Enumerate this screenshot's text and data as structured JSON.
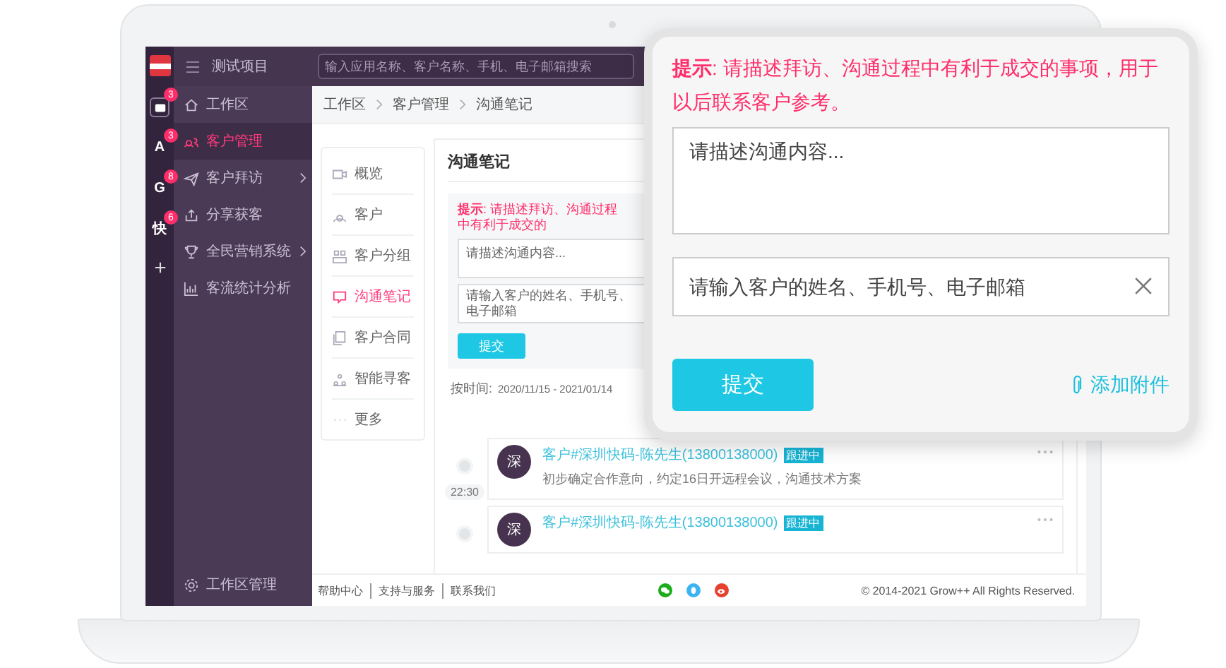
{
  "app": {
    "project": "测试项目",
    "search": {
      "placeholder": "输入应用名称、客户名称、手机、电子邮箱搜索"
    }
  },
  "rail": {
    "items": [
      {
        "badge": "3",
        "selected": true
      },
      {
        "label": "A",
        "badge": "3",
        "selected": false
      },
      {
        "label": "G",
        "badge": "8",
        "selected": false
      },
      {
        "label": "快",
        "badge": "6",
        "selected": false
      }
    ]
  },
  "sidebar": {
    "items": [
      {
        "label": "工作区",
        "selected": false,
        "has_submenu": false
      },
      {
        "label": "客户管理",
        "selected": true,
        "has_submenu": false
      },
      {
        "label": "客户拜访",
        "selected": false,
        "has_submenu": true
      },
      {
        "label": "分享获客",
        "selected": false,
        "has_submenu": false
      },
      {
        "label": "全民营销系统",
        "selected": false,
        "has_submenu": true
      },
      {
        "label": "客流统计分析",
        "selected": false,
        "has_submenu": false
      }
    ],
    "footer_item": "工作区管理"
  },
  "breadcrumb": [
    "工作区",
    "客户管理",
    "沟通笔记"
  ],
  "submenu": {
    "items": [
      {
        "label": "概览",
        "selected": false
      },
      {
        "label": "客户",
        "selected": false
      },
      {
        "label": "客户分组",
        "selected": false
      },
      {
        "label": "沟通笔记",
        "selected": true
      },
      {
        "label": "客户合同",
        "selected": false
      },
      {
        "label": "智能寻客",
        "selected": false
      },
      {
        "label": "更多",
        "selected": false
      }
    ]
  },
  "notes": {
    "title": "沟通笔记",
    "hint": "**提示**: 请描述拜访、沟通过程中有利于成交的",
    "content": {
      "placeholder": "请描述沟通内容..."
    },
    "customer": {
      "placeholder": "请输入客户的姓名、手机号、电子邮箱"
    },
    "submit": "提交",
    "filter": {
      "label": "按时间:",
      "range": "2020/11/15 - 2021/01/14"
    },
    "feed": [
      {
        "avatar": "深",
        "title": "客户#深圳快码-陈先生(13800138000)",
        "status": "跟进中",
        "text": "初步确定合作意向，约定16日开远程会议，沟通技术方案",
        "time": "22:30"
      },
      {
        "avatar": "深",
        "title": "客户#深圳快码-陈先生(13800138000)",
        "status": "跟进中"
      }
    ]
  },
  "footer": {
    "links": [
      "帮助中心",
      "支持与服务",
      "联系我们"
    ],
    "copyright": "© 2014-2021 Grow++ All Rights Reserved."
  },
  "popup": {
    "hint": "**提示**: 请描述拜访、沟通过程中有利于成交的事项，用于以后联系客户参考。",
    "content": {
      "placeholder": "请描述沟通内容..."
    },
    "customer": {
      "placeholder": "请输入客户的姓名、手机号、电子邮箱"
    },
    "submit": "提交",
    "attach": "添加附件"
  }
}
